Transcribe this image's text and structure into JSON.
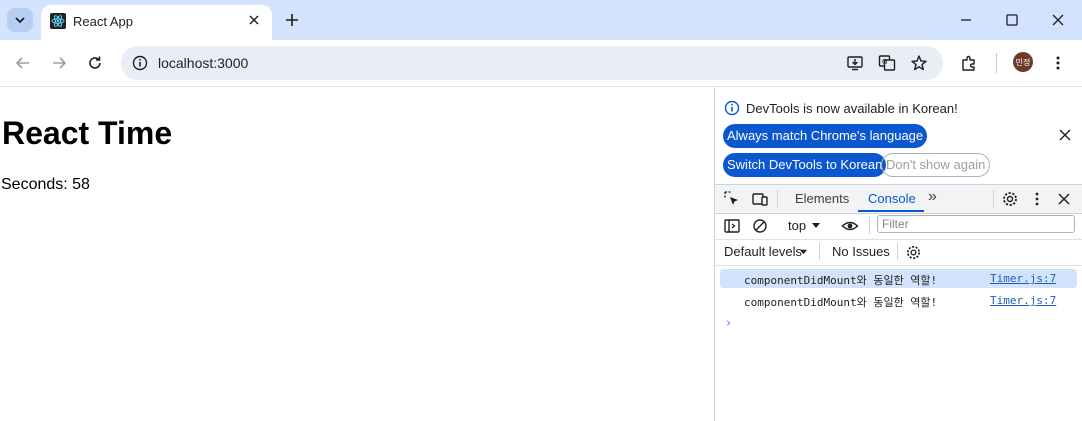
{
  "browser": {
    "tab_title": "React App",
    "url": "localhost:3000",
    "profile_initials": "민정"
  },
  "page": {
    "heading": "React Time",
    "seconds_label": "Seconds: 58"
  },
  "devtools": {
    "infobar": {
      "message": "DevTools is now available in Korean!",
      "always_match": "Always match Chrome's language",
      "switch_korean": "Switch DevTools to Korean",
      "dont_show": "Don't show again"
    },
    "tabs": {
      "elements": "Elements",
      "console": "Console",
      "more": "»"
    },
    "console": {
      "context": "top",
      "filter_placeholder": "Filter",
      "levels": "Default levels",
      "issues": "No Issues",
      "logs": [
        {
          "text": "componentDidMount와 동일한 역할!",
          "source": "Timer.js:7"
        },
        {
          "text": "componentDidMount와 동일한 역할!",
          "source": "Timer.js:7"
        }
      ],
      "prompt": "›"
    }
  },
  "colors": {
    "tabstrip": "#d3e3fd",
    "accent": "#0b57d0",
    "link": "#1a5fb4"
  }
}
